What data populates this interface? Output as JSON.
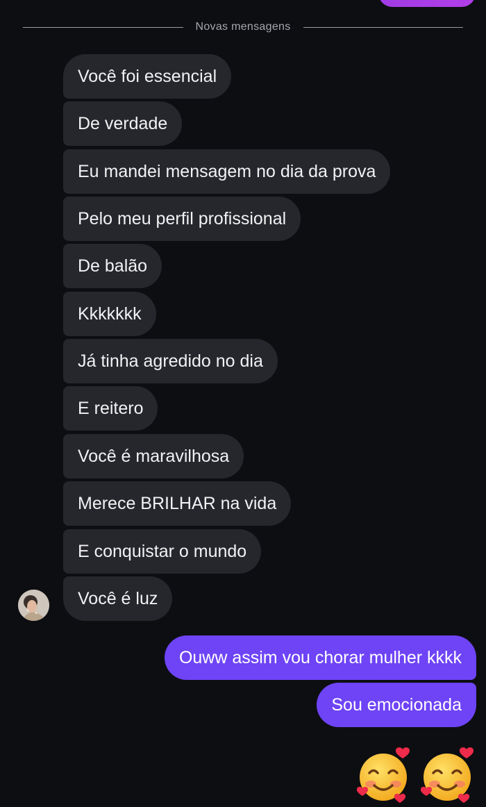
{
  "divider": {
    "label": "Novas mensagens"
  },
  "received_messages": [
    "Você foi essencial",
    "De verdade",
    "Eu mandei mensagem no dia da prova",
    "Pelo meu perfil profissional",
    "De balão",
    "Kkkkkkk",
    "Já tinha agredido no dia",
    "E reitero",
    "Você é maravilhosa",
    "Merece BRILHAR na vida",
    "E conquistar o mundo",
    "Você é luz"
  ],
  "sent_messages": [
    "Ouww assim vou chorar mulher kkkk",
    "Sou emocionada"
  ],
  "reaction": {
    "emoji_icon": "smiling-face-with-hearts-icon",
    "count": 2
  },
  "colors": {
    "background": "#0d0e12",
    "received_bubble": "#26272d",
    "sent_bubble": "#6e44f6",
    "top_sent_bubble": "#a23be6"
  }
}
